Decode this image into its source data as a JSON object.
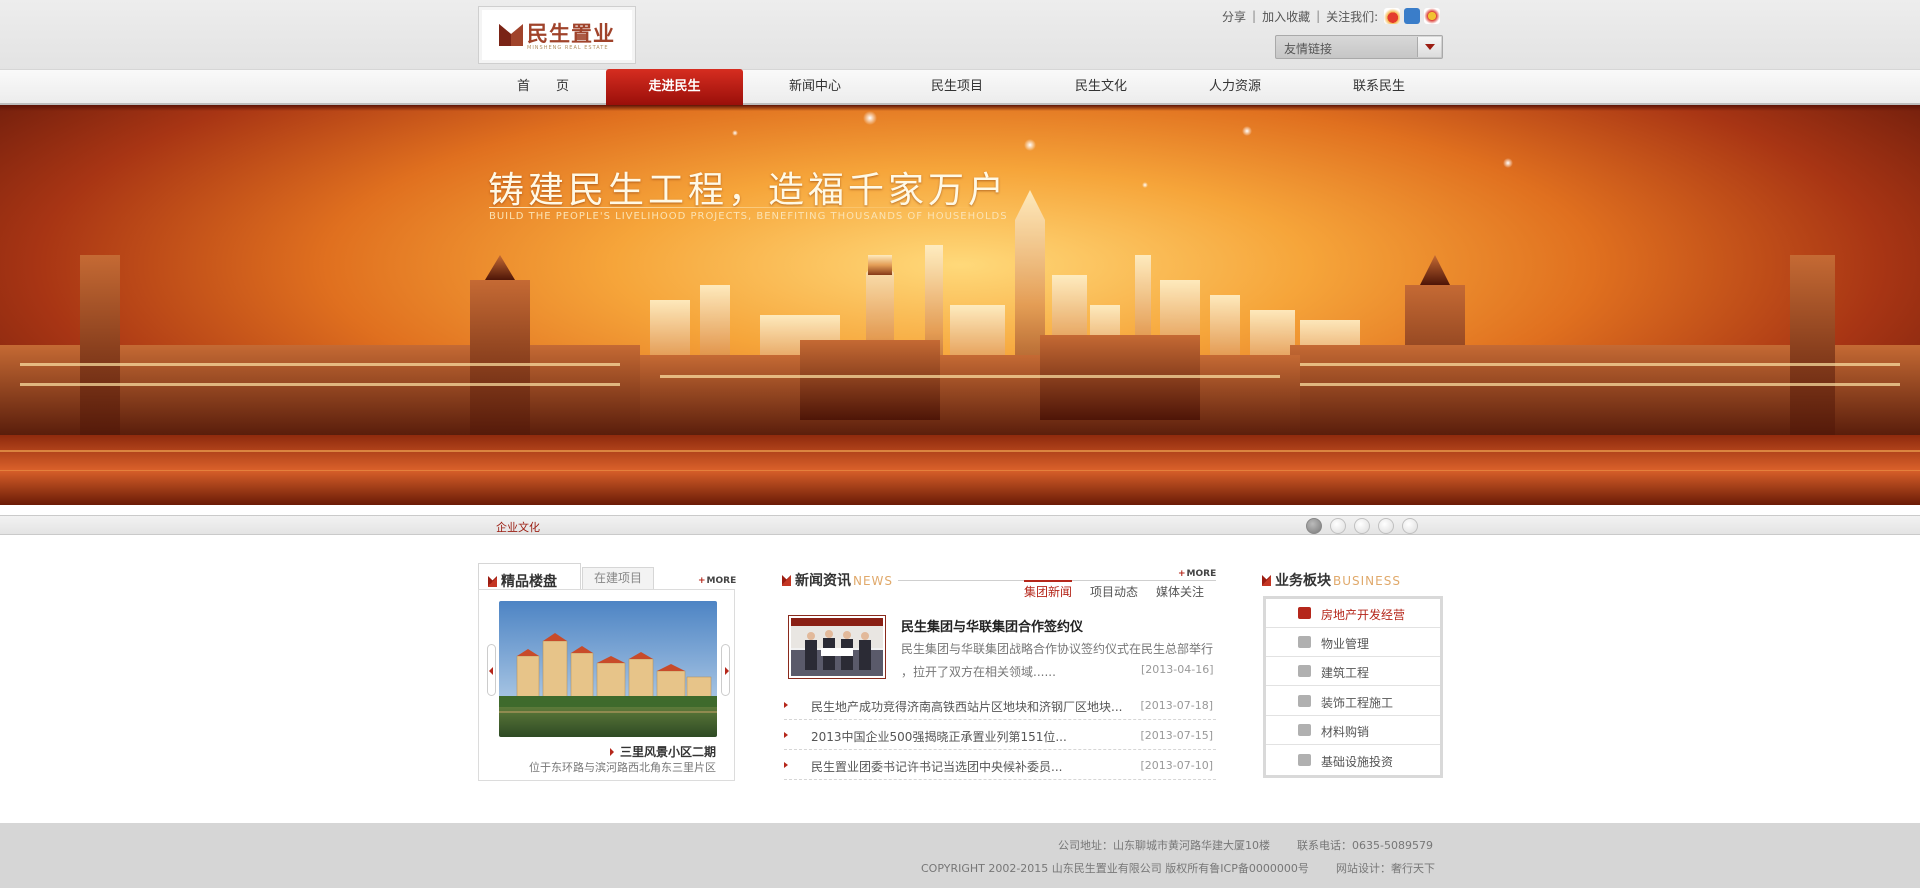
{
  "header": {
    "logo_cn": "民生置业",
    "logo_en": "MINSHENG REAL ESTATE",
    "share": "分享",
    "favorite": "加入收藏",
    "follow": "关注我们:",
    "friend_links": "友情链接"
  },
  "nav": [
    "首　　页",
    "走进民生",
    "新闻中心",
    "民生项目",
    "民生文化",
    "人力资源",
    "联系民生"
  ],
  "banner": {
    "slogan": "铸建民生工程，造福千家万户",
    "slogan_en": "BUILD THE PEOPLE'S LIVELIHOOD PROJECTS, BENEFITING THOUSANDS OF HOUSEHOLDS",
    "caption": "企业文化"
  },
  "featured": {
    "title": "精品楼盘",
    "tab2": "在建项目",
    "more": "MORE",
    "name": "三里风景小区二期",
    "desc": "位于东环路与滨河路西北角东三里片区"
  },
  "news": {
    "title": "新闻资讯",
    "title_en": "NEWS",
    "more": "MORE",
    "tabs": [
      "集团新闻",
      "项目动态",
      "媒体关注"
    ],
    "headline": "民生集团与华联集团合作签约仪",
    "summary1": "民生集团与华联集团战略合作协议签约仪式在民生总部举行",
    "summary2": "，拉开了双方在相关领域......",
    "headline_date": "[2013-04-16]",
    "items": [
      {
        "title": "民生地产成功竞得济南高铁西站片区地块和济钢厂区地块...",
        "date": "[2013-07-18]"
      },
      {
        "title": "2013中国企业500强揭晓正承置业列第151位...",
        "date": "[2013-07-15]"
      },
      {
        "title": "民生置业团委书记许书记当选团中央候补委员...",
        "date": "[2013-07-10]"
      }
    ]
  },
  "business": {
    "title": "业务板块",
    "title_en": "BUSINESS",
    "items": [
      "房地产开发经营",
      "物业管理",
      "建筑工程",
      "装饰工程施工",
      "材料购销",
      "基础设施投资"
    ]
  },
  "footer": {
    "address": "公司地址：山东聊城市黄河路华建大厦10楼",
    "phone": "联系电话：0635-5089579",
    "copyright": "COPYRIGHT 2002-2015 山东民生置业有限公司 版权所有鲁ICP备0000000号",
    "design": "网站设计：奢行天下"
  },
  "colors": {
    "brand_red": "#b5271b",
    "active_nav": "#c4221a",
    "accent_gold": "#e0a96b"
  }
}
